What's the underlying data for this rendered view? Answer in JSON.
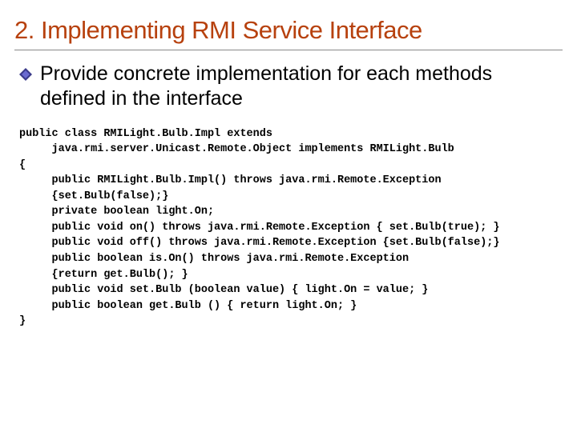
{
  "title": "2. Implementing RMI Service Interface",
  "bullet": "Provide concrete implementation for each methods defined in the interface",
  "code": "public class RMILight.Bulb.Impl extends\n     java.rmi.server.Unicast.Remote.Object implements RMILight.Bulb\n{\n     public RMILight.Bulb.Impl() throws java.rmi.Remote.Exception\n     {set.Bulb(false);}\n     private boolean light.On;\n     public void on() throws java.rmi.Remote.Exception { set.Bulb(true); }\n     public void off() throws java.rmi.Remote.Exception {set.Bulb(false);}\n     public boolean is.On() throws java.rmi.Remote.Exception\n     {return get.Bulb(); }\n     public void set.Bulb (boolean value) { light.On = value; }\n     public boolean get.Bulb () { return light.On; }\n}"
}
